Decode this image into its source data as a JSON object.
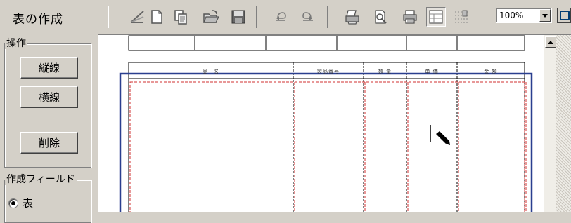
{
  "toolbar": {
    "title": "表の作成",
    "zoom": "100%",
    "icons": [
      "draw-line-icon",
      "new-document-icon",
      "copy-document-icon",
      "open-folder-icon",
      "save-icon",
      "undo-icon",
      "redo-icon",
      "print-icon",
      "print-preview-icon",
      "printer-setup-icon",
      "table-view-icon",
      "grid-icon"
    ]
  },
  "panel": {
    "operations_label": "操作",
    "vertical_line_label": "縦線",
    "horizontal_line_label": "横線",
    "delete_label": "削除",
    "field_group_label": "作成フィールド",
    "table_radio_label": "表"
  },
  "form": {
    "headers": [
      "品　名",
      "製品番号",
      "数 量",
      "単 価",
      "金 額"
    ]
  },
  "colors": {
    "frame_blue": "#2a3f8f",
    "dashed_red": "#d03030",
    "window_bg": "#d4d0c8"
  }
}
